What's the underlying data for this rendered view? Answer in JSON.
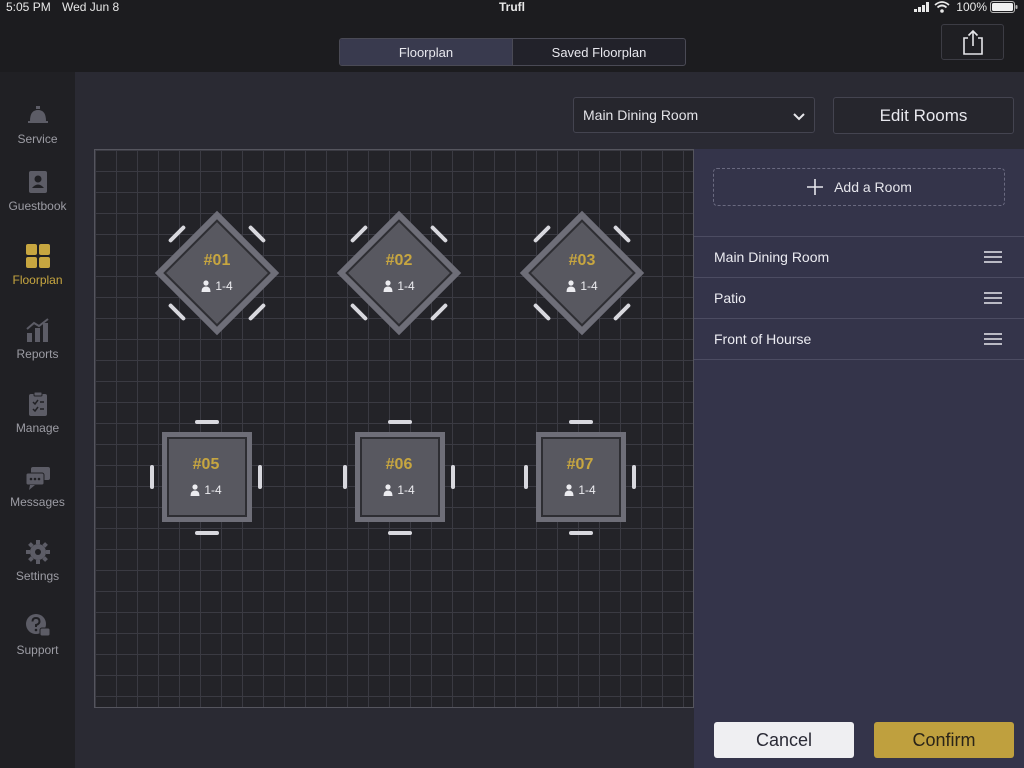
{
  "status_bar": {
    "time": "5:05 PM",
    "date": "Wed Jun 8",
    "app_name": "Trufl",
    "battery": "100%"
  },
  "top_tabs": [
    {
      "label": "Floorplan",
      "active": true
    },
    {
      "label": "Saved Floorplan",
      "active": false
    }
  ],
  "share_icon": "share-icon",
  "sidebar": {
    "items": [
      {
        "label": "Service",
        "icon": "service-bell-icon"
      },
      {
        "label": "Guestbook",
        "icon": "guestbook-icon"
      },
      {
        "label": "Floorplan",
        "icon": "floorplan-grid-icon",
        "active": true
      },
      {
        "label": "Reports",
        "icon": "reports-chart-icon"
      },
      {
        "label": "Manage",
        "icon": "clipboard-icon"
      },
      {
        "label": "Messages",
        "icon": "messages-icon"
      },
      {
        "label": "Settings",
        "icon": "gear-icon"
      },
      {
        "label": "Support",
        "icon": "support-icon"
      }
    ]
  },
  "room_selector": {
    "value": "Main Dining Room"
  },
  "edit_rooms_label": "Edit Rooms",
  "tables": [
    {
      "label": "#01",
      "capacity": "1-4",
      "shape": "diamond"
    },
    {
      "label": "#02",
      "capacity": "1-4",
      "shape": "diamond"
    },
    {
      "label": "#03",
      "capacity": "1-4",
      "shape": "diamond"
    },
    {
      "label": "#05",
      "capacity": "1-4",
      "shape": "square"
    },
    {
      "label": "#06",
      "capacity": "1-4",
      "shape": "square"
    },
    {
      "label": "#07",
      "capacity": "1-4",
      "shape": "square"
    }
  ],
  "rooms_panel": {
    "add_room_label": "Add a Room",
    "rooms": [
      {
        "name": "Main Dining Room"
      },
      {
        "name": "Patio"
      },
      {
        "name": "Front of Hourse"
      }
    ]
  },
  "actions": {
    "cancel_label": "Cancel",
    "confirm_label": "Confirm"
  },
  "colors": {
    "accent_gold": "#c7a640",
    "panel_bg": "#34344a",
    "background": "#2a2a33"
  }
}
